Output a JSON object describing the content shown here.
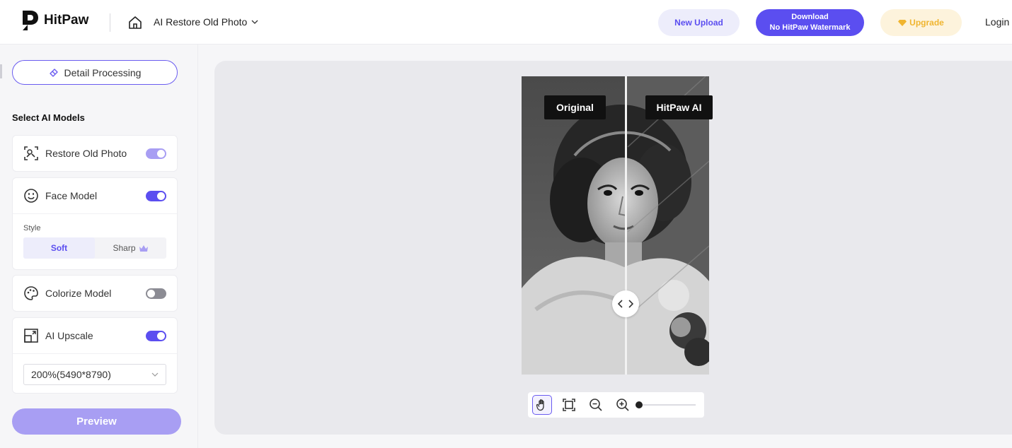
{
  "header": {
    "brand": "HitPaw",
    "tool_name": "AI Restore Old Photo",
    "new_upload_label": "New Upload",
    "download_line1": "Download",
    "download_line2": "No HitPaw Watermark",
    "upgrade_label": "Upgrade",
    "login_label": "Login"
  },
  "sidebar": {
    "detail_label": "Detail Processing",
    "section_title": "Select AI Models",
    "models": [
      {
        "label": "Restore Old Photo",
        "enabled": true
      },
      {
        "label": "Face Model",
        "enabled": true
      },
      {
        "label": "Colorize Model",
        "enabled": false
      },
      {
        "label": "AI Upscale",
        "enabled": true
      }
    ],
    "style_label": "Style",
    "style_options": [
      "Soft",
      "Sharp"
    ],
    "style_selected": "Soft",
    "upscale_value": "200%(5490*8790)",
    "preview_label": "Preview"
  },
  "canvas": {
    "original_tag": "Original",
    "ai_tag": "HitPaw AI",
    "zoom_level": 0.0
  },
  "colors": {
    "accent": "#5b4ef0",
    "accent_light": "#a89ef3",
    "upgrade": "#f0b530"
  },
  "icons": [
    "home-icon",
    "chevron-down-icon",
    "diamond-icon",
    "eraser-icon",
    "restore-icon",
    "face-icon",
    "palette-icon",
    "upscale-icon",
    "crown-icon",
    "hand-icon",
    "fit-screen-icon",
    "zoom-out-icon",
    "zoom-in-icon"
  ]
}
